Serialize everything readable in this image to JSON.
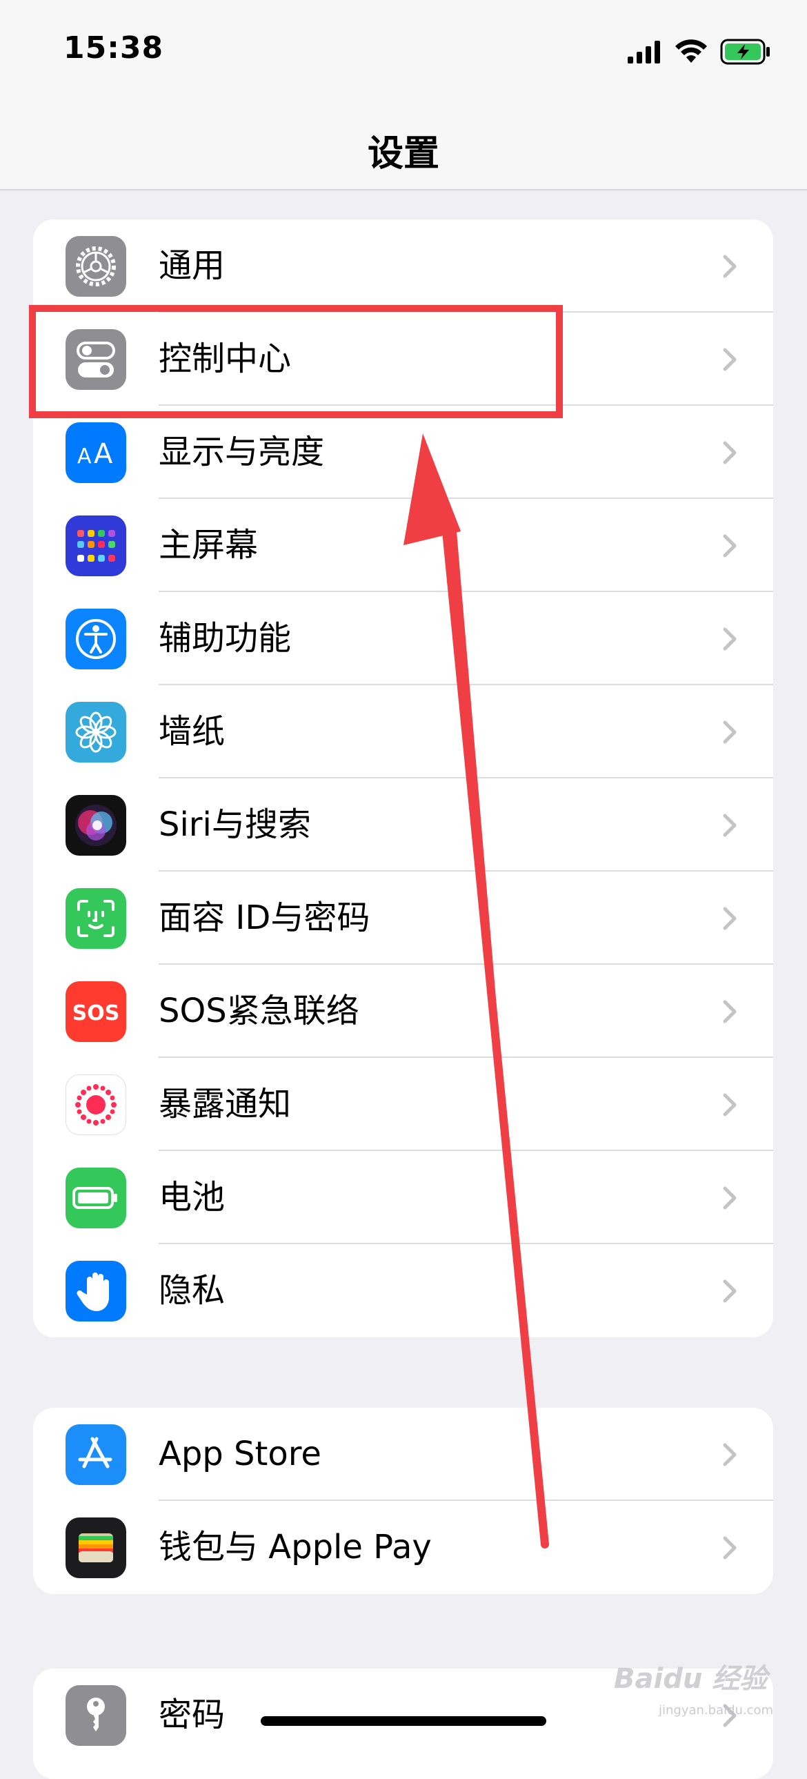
{
  "status_bar": {
    "time": "15:38",
    "icons": [
      "cellular-signal-icon",
      "wifi-icon",
      "battery-charging-icon"
    ],
    "battery_color": "#34c759"
  },
  "nav": {
    "title": "设置"
  },
  "groups": [
    {
      "items": [
        {
          "label": "通用",
          "icon": "gear-icon",
          "color": "#8e8e93"
        },
        {
          "label": "控制中心",
          "icon": "toggle-switches-icon",
          "color": "#8e8e93"
        },
        {
          "label": "显示与亮度",
          "icon": "text-size-aa-icon",
          "color": "#007aff"
        },
        {
          "label": "主屏幕",
          "icon": "home-screen-grid-icon",
          "color": "#2f3ad9"
        },
        {
          "label": "辅助功能",
          "icon": "accessibility-person-icon",
          "color": "#0a84ff"
        },
        {
          "label": "墙纸",
          "icon": "flower-icon",
          "color": "#34aadc"
        },
        {
          "label": "Siri与搜索",
          "icon": "siri-orb-icon",
          "color": "#111111"
        },
        {
          "label": "面容 ID与密码",
          "icon": "face-id-icon",
          "color": "#34c759"
        },
        {
          "label": "SOS紧急联络",
          "icon": "sos-icon",
          "color": "#ff3b30"
        },
        {
          "label": "暴露通知",
          "icon": "exposure-dot-icon",
          "color": "#ffffff"
        },
        {
          "label": "电池",
          "icon": "battery-icon",
          "color": "#34c759"
        },
        {
          "label": "隐私",
          "icon": "hand-icon",
          "color": "#007aff"
        }
      ]
    },
    {
      "items": [
        {
          "label": "App Store",
          "icon": "app-store-icon",
          "color": "#1c8ef9"
        },
        {
          "label": "钱包与 Apple Pay",
          "icon": "wallet-icon",
          "color": "#1c1c1e"
        }
      ]
    },
    {
      "items": [
        {
          "label": "密码",
          "icon": "key-icon",
          "color": "#8e8e93"
        }
      ]
    }
  ],
  "annotation": {
    "highlight_color": "#ef3f45",
    "highlighted_item": "控制中心"
  },
  "watermark": {
    "text": "Baidu 经验",
    "sub": "jingyan.baidu.com"
  }
}
